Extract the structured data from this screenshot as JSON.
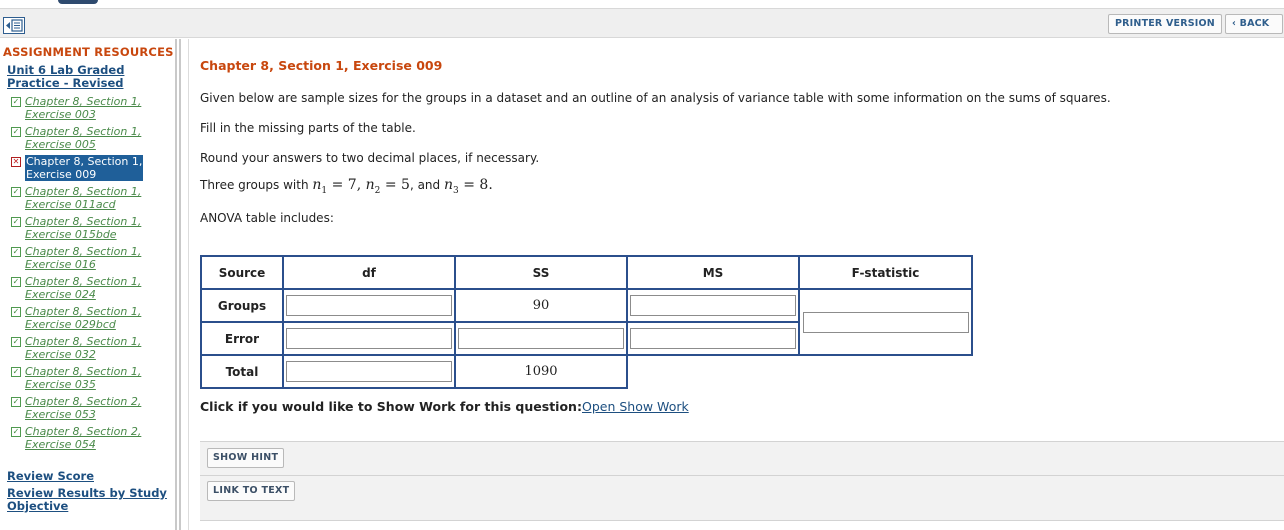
{
  "toolbar": {
    "printer_label": "PRINTER VERSION",
    "back_label": "‹ BACK"
  },
  "sidebar": {
    "title": "ASSIGNMENT RESOURCES",
    "unit_link": "Unit 6 Lab Graded Practice - Revised",
    "items": [
      {
        "line1": "Chapter 8, Section 1,",
        "line2": "Exercise 003",
        "status": "done"
      },
      {
        "line1": "Chapter 8, Section 1,",
        "line2": "Exercise 005",
        "status": "done"
      },
      {
        "line1": "Chapter 8, Section 1,",
        "line2": "Exercise 009",
        "status": "error"
      },
      {
        "line1": "Chapter 8, Section 1,",
        "line2": "Exercise 011acd",
        "status": "done"
      },
      {
        "line1": "Chapter 8, Section 1,",
        "line2": "Exercise 015bde",
        "status": "done"
      },
      {
        "line1": "Chapter 8, Section 1,",
        "line2": "Exercise 016",
        "status": "done"
      },
      {
        "line1": "Chapter 8, Section 1,",
        "line2": "Exercise 024",
        "status": "done"
      },
      {
        "line1": "Chapter 8, Section 1,",
        "line2": "Exercise 029bcd",
        "status": "done"
      },
      {
        "line1": "Chapter 8, Section 1,",
        "line2": "Exercise 032",
        "status": "done"
      },
      {
        "line1": "Chapter 8, Section 1,",
        "line2": "Exercise 035",
        "status": "done"
      },
      {
        "line1": "Chapter 8, Section 2,",
        "line2": "Exercise 053",
        "status": "done"
      },
      {
        "line1": "Chapter 8, Section 2,",
        "line2": "Exercise 054",
        "status": "done"
      }
    ],
    "review_score": "Review Score",
    "review_results": "Review Results by Study Objective"
  },
  "main": {
    "title": "Chapter 8, Section 1, Exercise 009",
    "para1": "Given below are sample sizes for the groups in a dataset and an outline of an analysis of variance table with some information on the sums of squares.",
    "para2": "Fill in the missing parts of the table.",
    "para3": "Round your answers to two decimal places, if necessary.",
    "groups_prefix": "Three groups with",
    "n1": "7",
    "n2": "5",
    "n3": "8",
    "and_text": ", and",
    "anova_label": "ANOVA table includes:",
    "table": {
      "headers": [
        "Source",
        "df",
        "SS",
        "MS",
        "F-statistic"
      ],
      "row_groups": "Groups",
      "row_error": "Error",
      "row_total": "Total",
      "ss_groups": "90",
      "ss_total": "1090"
    },
    "showwork_prompt": "Click if you would like to Show Work for this question:",
    "showwork_link": "Open Show Work",
    "show_hint": "SHOW HINT",
    "link_to_text": "LINK TO TEXT"
  },
  "colors": {
    "accent_orange": "#c8470e",
    "link_blue": "#1d4f80",
    "table_border": "#2b4f8c",
    "done_green": "#4a8a4a",
    "active_bg": "#1f5f99"
  }
}
